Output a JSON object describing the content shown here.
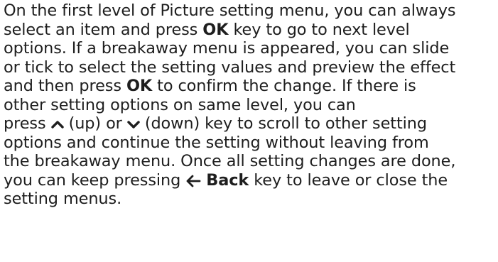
{
  "document": {
    "lines": [
      {
        "text": "On the first level of Picture setting menu, you can always"
      },
      {
        "pre": "select an item and press ",
        "key": "OK",
        "post": " key to go to next level"
      },
      {
        "text": "options. If a breakaway menu is appeared, you can slide"
      },
      {
        "text": "or tick to select the setting values and preview the effect"
      },
      {
        "pre": "and then press ",
        "key": "OK",
        "post": " to confirm the change. If there is"
      },
      {
        "text": "other setting options on same level, you can"
      },
      {
        "pre": "press ",
        "mid1": " (up) or ",
        "post": " (down) key to scroll to other setting"
      },
      {
        "text": "options and continue the setting without leaving from"
      },
      {
        "text": "the breakaway menu. Once all setting changes are done,"
      },
      {
        "pre": "you can keep pressing ",
        "key": "Back",
        "post": " key to leave or close the"
      },
      {
        "text": "setting menus."
      }
    ]
  },
  "icons": {
    "up": "chevron-up-icon",
    "down": "chevron-down-icon",
    "back": "arrow-left-icon"
  }
}
